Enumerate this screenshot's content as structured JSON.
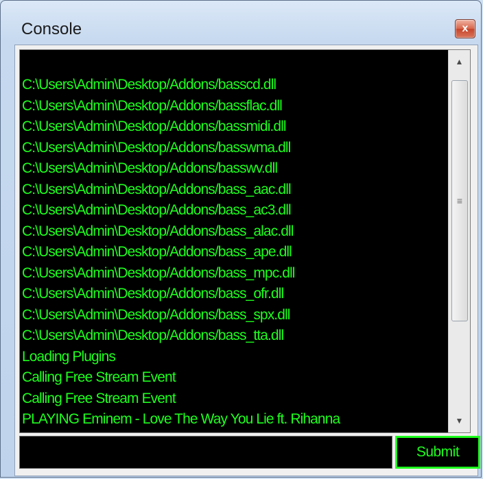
{
  "window": {
    "title": "Console",
    "close_glyph": "x"
  },
  "console": {
    "text_color": "#1eff1e",
    "background": "#000000",
    "lines": [
      "C:\\Users\\Admin\\Desktop/Addons/basscd.dll",
      "C:\\Users\\Admin\\Desktop/Addons/bassflac.dll",
      "C:\\Users\\Admin\\Desktop/Addons/bassmidi.dll",
      "C:\\Users\\Admin\\Desktop/Addons/basswma.dll",
      "C:\\Users\\Admin\\Desktop/Addons/basswv.dll",
      "C:\\Users\\Admin\\Desktop/Addons/bass_aac.dll",
      "C:\\Users\\Admin\\Desktop/Addons/bass_ac3.dll",
      "C:\\Users\\Admin\\Desktop/Addons/bass_alac.dll",
      "C:\\Users\\Admin\\Desktop/Addons/bass_ape.dll",
      "C:\\Users\\Admin\\Desktop/Addons/bass_mpc.dll",
      "C:\\Users\\Admin\\Desktop/Addons/bass_ofr.dll",
      "C:\\Users\\Admin\\Desktop/Addons/bass_spx.dll",
      "C:\\Users\\Admin\\Desktop/Addons/bass_tta.dll",
      "Loading Plugins",
      "Calling Free Stream Event",
      "Calling Free Stream Event",
      "PLAYING Eminem - Love The Way You Lie ft. Rihanna"
    ]
  },
  "scrollbar": {
    "up_icon": "▲",
    "down_icon": "▼",
    "grip_icon": "≡"
  },
  "command": {
    "value": "",
    "placeholder": "",
    "submit_label": "Submit"
  }
}
